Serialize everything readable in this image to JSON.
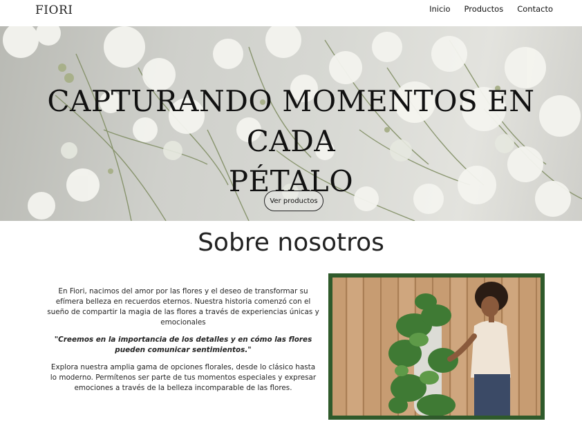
{
  "header": {
    "logo": "FIORI",
    "nav": [
      "Inicio",
      "Productos",
      "Contacto"
    ]
  },
  "hero": {
    "title_line1": "CAPTURANDO MOMENTOS EN CADA",
    "title_line2": "PÉTALO",
    "button_label": "Ver productos"
  },
  "about": {
    "title": "Sobre nosotros",
    "paragraph1": "En Fiori, nacimos del amor por las flores y el deseo de transformar su efímera belleza en recuerdos eternos. Nuestra historia comenzó con el sueño de compartir la magia de las flores a través de experiencias únicas y emocionales",
    "quote": "\"Creemos en la importancia de los detalles y en cómo las flores pueden comunicar sentimientos.\"",
    "paragraph2": "Explora nuestra amplia gama de opciones florales, desde lo clásico hasta lo moderno. Permítenos ser parte de tus momentos especiales y expresar emociones a través de la belleza incomparable de las flores."
  },
  "colors": {
    "frame": "#2f5a2b",
    "text": "#222222"
  }
}
